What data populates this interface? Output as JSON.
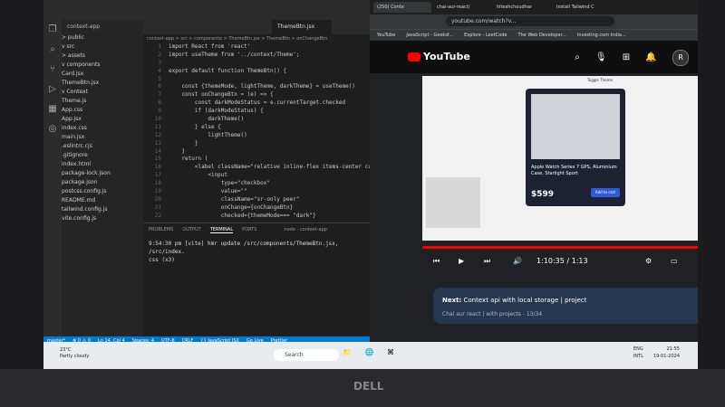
{
  "vscode": {
    "sidebar_root": "context-app",
    "tree": [
      "> public",
      "v src",
      "  > assets",
      "  v components",
      "     Card.jsx",
      "     ThemeBtn.jsx",
      "  v Context",
      "     Theme.js",
      "  App.css",
      "  App.jsx",
      "  index.css",
      "  main.jsx",
      ".eslintrc.cjs",
      ".gitignore",
      "index.html",
      "package-lock.json",
      "package.json",
      "postcss.config.js",
      "README.md",
      "tailwind.config.js",
      "vite.config.js"
    ],
    "active_tab": "ThemeBtn.jsx",
    "breadcrumb": "context-app > src > components > ThemeBtn.jsx > ThemeBtn > onChangeBtn",
    "code_lines": [
      {
        "n": "1",
        "t": "import React from 'react'"
      },
      {
        "n": "2",
        "t": "import useTheme from '../context/Theme';"
      },
      {
        "n": "3",
        "t": ""
      },
      {
        "n": "4",
        "t": "export default function ThemeBtn() {"
      },
      {
        "n": "5",
        "t": ""
      },
      {
        "n": "6",
        "t": "    const {themeMode, lightTheme, darkTheme} = useTheme()"
      },
      {
        "n": "7",
        "t": "    const onChangeBtn = (e) => {"
      },
      {
        "n": "8",
        "t": "        const darkModeStatus = e.currentTarget.checked"
      },
      {
        "n": "9",
        "t": "        if (darkModeStatus) {"
      },
      {
        "n": "10",
        "t": "            darkTheme()"
      },
      {
        "n": "11",
        "t": "        } else {"
      },
      {
        "n": "12",
        "t": "            lightTheme()"
      },
      {
        "n": "13",
        "t": "        }"
      },
      {
        "n": "14",
        "t": "    }"
      },
      {
        "n": "15",
        "t": "    return ("
      },
      {
        "n": "16",
        "t": "        <label className=\"relative inline-flex items-center cu"
      },
      {
        "n": "17",
        "t": "            <input"
      },
      {
        "n": "18",
        "t": "                type=\"checkbox\""
      },
      {
        "n": "19",
        "t": "                value=\"\""
      },
      {
        "n": "20",
        "t": "                className=\"sr-only peer\""
      },
      {
        "n": "21",
        "t": "                onChange={onChangeBtn}"
      },
      {
        "n": "22",
        "t": "                checked={themeMode=== \"dark\"}"
      }
    ],
    "panel_tabs": [
      "PROBLEMS",
      "OUTPUT",
      "TERMINAL",
      "PORTS"
    ],
    "terminal_name": "node - context-app",
    "terminal_lines": [
      "9:54:30 pm [vite] hmr update /src/components/ThemeBtn.jsx, /src/index.",
      "css (x3)"
    ],
    "status": [
      "master*",
      "⊗ 0 ⚠ 0",
      "Ln 14, Col 4",
      "Spaces: 4",
      "UTF-8",
      "CRLF",
      "{} JavaScript JSX",
      "Go Live",
      "Prettier"
    ]
  },
  "browser": {
    "tabs": [
      "(250) Conte",
      "chai-aur-react/",
      "hiteshchoudhar",
      "Install Tailwind C"
    ],
    "url": "youtube.com/watch?v...",
    "bookmarks": [
      "YouTube",
      "JavaScript - Geeksf...",
      "Explore - LeetCode",
      "The Web Developer...",
      "Investing.com India..."
    ],
    "yt_logo": "YouTube",
    "yt_country": "IN",
    "notification_count": "9+",
    "avatar_letter": "R",
    "video": {
      "toggle_label": "Toggle Theme",
      "product_title": "Apple Watch Series 7 GPS, Aluminium Case, Starlight Sport",
      "rating": "4.0",
      "price": "$599",
      "cart_button": "Add to cart"
    },
    "progress": 0.98,
    "time": "1:10:35 / 1:13",
    "hd_badge": "HD",
    "next": {
      "prefix": "Next:",
      "title": "Context api with local storage | project",
      "subtitle": "Chai aur react | with projects - 13/34"
    }
  },
  "taskbar": {
    "temp": "23°C",
    "weather": "Partly cloudy",
    "search": "Search",
    "lang": [
      "ENG",
      "INTL"
    ],
    "time": "21:55",
    "date": "19-01-2024"
  },
  "bezel_brand": "DELL"
}
